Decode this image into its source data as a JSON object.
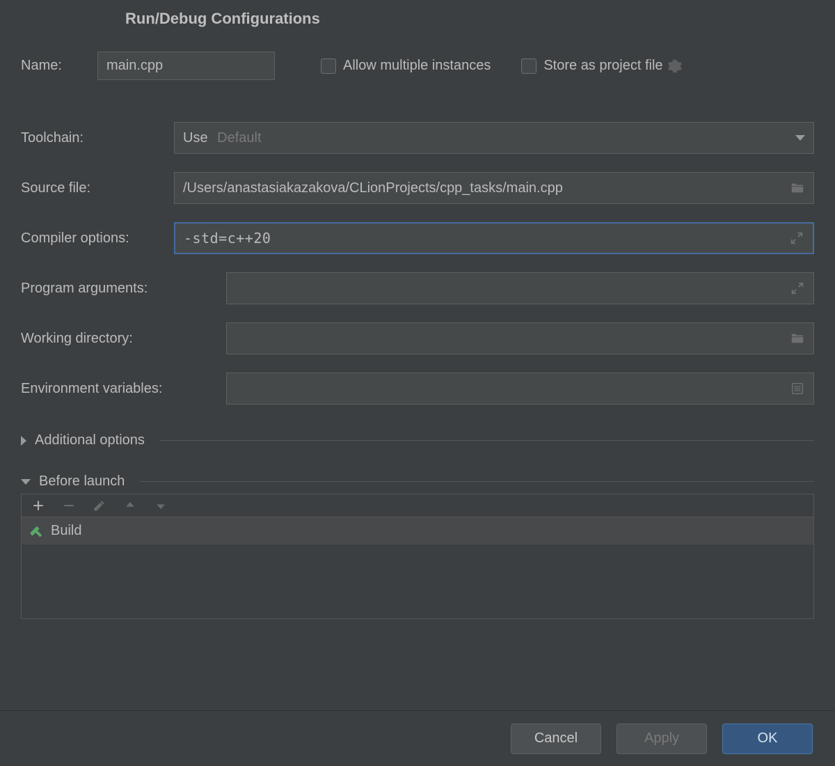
{
  "dialog": {
    "title": "Run/Debug Configurations"
  },
  "fields": {
    "name_label": "Name:",
    "name_value": "main.cpp",
    "allow_multi_label": "Allow multiple instances",
    "store_file_label": "Store as project file",
    "toolchain_label": "Toolchain:",
    "toolchain_use": "Use",
    "toolchain_selected": "Default",
    "source_label": "Source file:",
    "source_value": "/Users/anastasiakazakova/CLionProjects/cpp_tasks/main.cpp",
    "compiler_label": "Compiler options:",
    "compiler_value": "-std=c++20",
    "progargs_label": "Program arguments:",
    "progargs_value": "",
    "workdir_label": "Working directory:",
    "workdir_value": "",
    "envvars_label": "Environment variables:",
    "envvars_value": ""
  },
  "sections": {
    "additional": "Additional options",
    "before_launch": "Before launch"
  },
  "before_launch": {
    "items": [
      {
        "label": "Build"
      }
    ]
  },
  "buttons": {
    "cancel": "Cancel",
    "apply": "Apply",
    "ok": "OK"
  }
}
